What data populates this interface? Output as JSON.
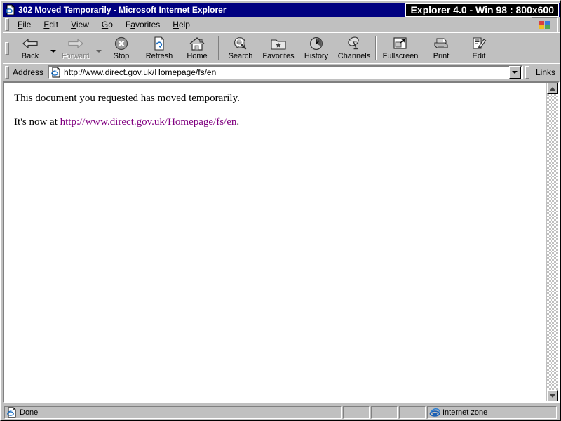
{
  "window": {
    "title": "302 Moved Temporarily - Microsoft Internet Explorer",
    "title_icon": "ie-document-icon",
    "overlay_label": "Explorer 4.0 - Win 98 : 800x600"
  },
  "menu": {
    "items": [
      {
        "label": "File",
        "accel": "F"
      },
      {
        "label": "Edit",
        "accel": "E"
      },
      {
        "label": "View",
        "accel": "V"
      },
      {
        "label": "Go",
        "accel": "G"
      },
      {
        "label": "Favorites",
        "accel": "a"
      },
      {
        "label": "Help",
        "accel": "H"
      }
    ],
    "logo_icon": "windows-flag-icon"
  },
  "toolbar": {
    "buttons": [
      {
        "label": "Back",
        "icon": "arrow-left-icon",
        "disabled": false,
        "dropdown": true
      },
      {
        "label": "Forward",
        "icon": "arrow-right-icon",
        "disabled": true,
        "dropdown": true
      },
      {
        "label": "Stop",
        "icon": "stop-icon",
        "disabled": false,
        "dropdown": false
      },
      {
        "label": "Refresh",
        "icon": "refresh-icon",
        "disabled": false,
        "dropdown": false
      },
      {
        "label": "Home",
        "icon": "home-icon",
        "disabled": false,
        "dropdown": false
      },
      {
        "label": "Search",
        "icon": "search-icon",
        "disabled": false,
        "dropdown": false
      },
      {
        "label": "Favorites",
        "icon": "favorites-folder-icon",
        "disabled": false,
        "dropdown": false
      },
      {
        "label": "History",
        "icon": "history-icon",
        "disabled": false,
        "dropdown": false
      },
      {
        "label": "Channels",
        "icon": "channels-icon",
        "disabled": false,
        "dropdown": false
      },
      {
        "label": "Fullscreen",
        "icon": "fullscreen-icon",
        "disabled": false,
        "dropdown": false
      },
      {
        "label": "Print",
        "icon": "printer-icon",
        "disabled": false,
        "dropdown": false
      },
      {
        "label": "Edit",
        "icon": "edit-pencil-icon",
        "disabled": false,
        "dropdown": false
      }
    ]
  },
  "address": {
    "label": "Address",
    "value": "http://www.direct.gov.uk/Homepage/fs/en",
    "placeholder": "",
    "icon": "ie-document-icon",
    "links_label": "Links"
  },
  "page": {
    "line1": "This document you requested has moved temporarily.",
    "line2_prefix": "It's now at ",
    "link_text": "http://www.direct.gov.uk/Homepage/fs/en",
    "line2_suffix": ".",
    "link_color": "#800080"
  },
  "status": {
    "main_text": "Done",
    "main_icon": "ie-document-icon",
    "zone_text": "Internet zone",
    "zone_icon": "ie-e-logo-icon"
  }
}
